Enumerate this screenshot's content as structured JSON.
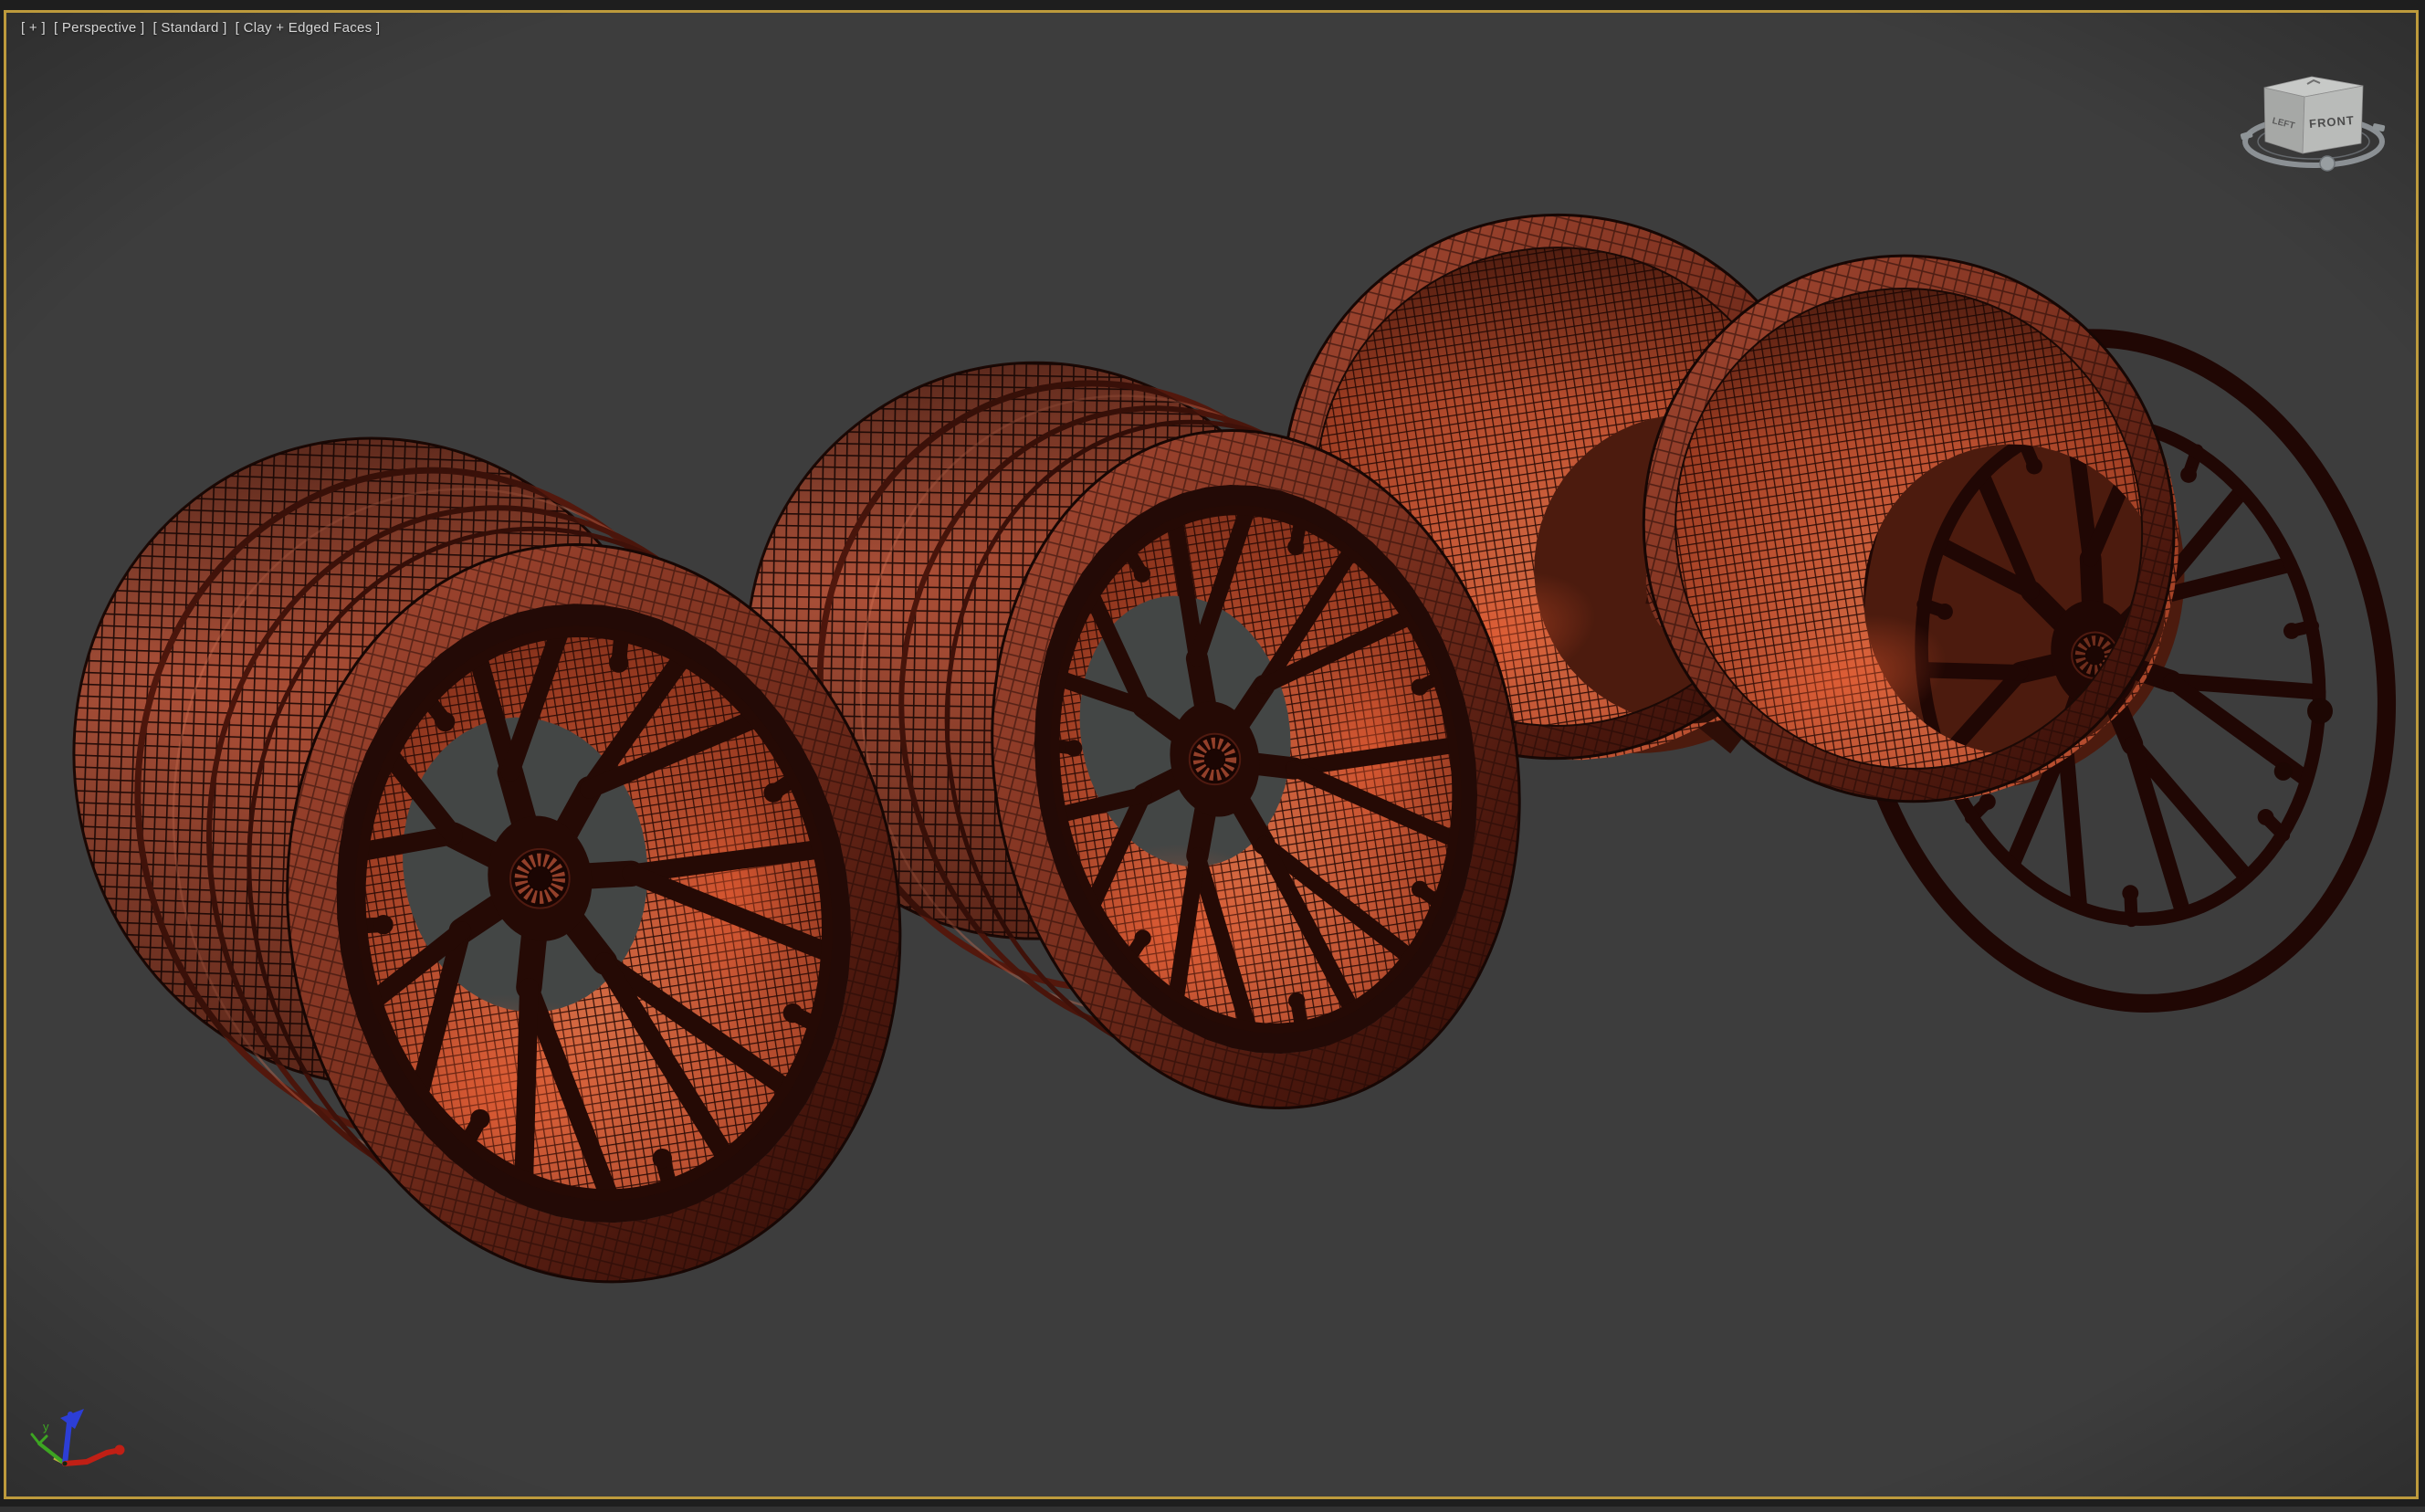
{
  "viewport": {
    "label_segments": [
      {
        "name": "general-menu",
        "text": "[ + ]"
      },
      {
        "name": "point-of-view-menu",
        "text": "[ Perspective ]"
      },
      {
        "name": "renderer-menu",
        "text": "[ Standard ]"
      },
      {
        "name": "shading-menu",
        "text": "[ Clay + Edged Faces ]"
      }
    ]
  },
  "viewcube": {
    "front_label": "FRONT",
    "left_label": "LEFT"
  },
  "axis_tripod": {
    "y_label": "y"
  },
  "scene": {
    "object_count": 4,
    "shading_mode": "Clay + Edged Faces"
  },
  "colors": {
    "frame": "#1e1e1e",
    "active_viewport_border": "#bd9a3c",
    "viewport_background": "#3d3d3d",
    "label_text": "#d6d6d6",
    "clay_lit": "#c05c42",
    "clay_base": "#a04831",
    "clay_shadow": "#541d10",
    "clay_inner_bright": "#d46b44",
    "wireframe_edge": "#1e0804",
    "spoke_silhouette": "#250a05",
    "through_hole": "#434645",
    "viewcube_face": "#b9bbb9",
    "viewcube_ring": "#8b9094",
    "axis_x": "#c01f15",
    "axis_y": "#3da522",
    "axis_z": "#2c3ed6"
  }
}
